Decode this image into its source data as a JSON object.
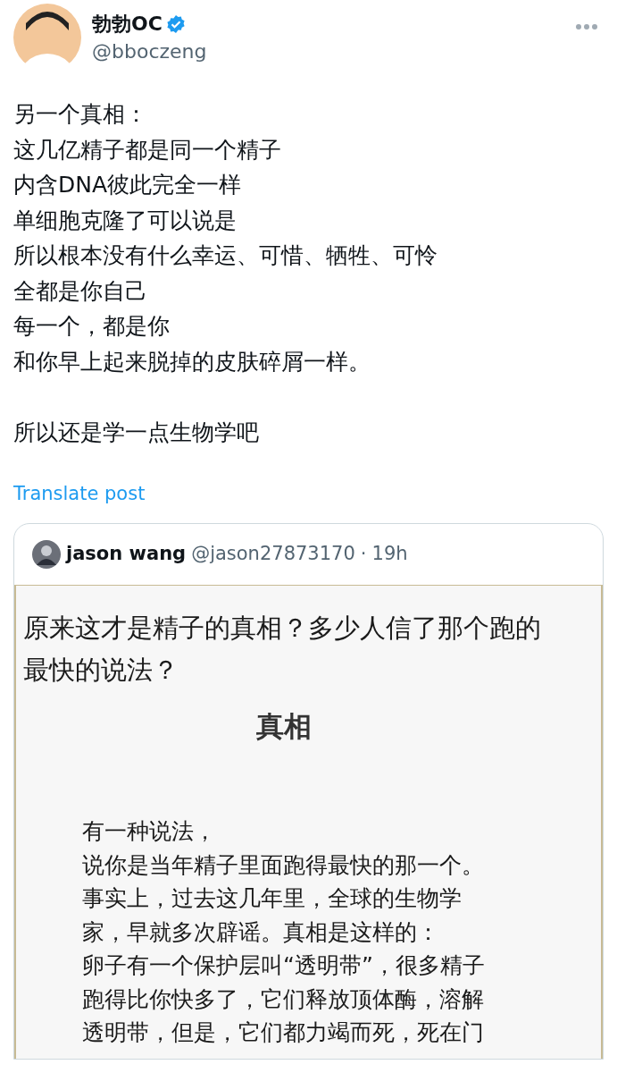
{
  "author": {
    "name": "勃勃OC",
    "verified": true,
    "handle": "@bboczeng"
  },
  "body": [
    [
      "另一个真相：",
      "这几亿精子都是同一个精子",
      "内含DNA彼此完全一样",
      "单细胞克隆了可以说是",
      "所以根本没有什么幸运、可惜、牺牲、可怜",
      "全都是你自己",
      "每一个，都是你",
      "和你早上起来脱掉的皮肤碎屑一样。"
    ],
    [
      "所以还是学一点生物学吧"
    ]
  ],
  "translate_link": "Translate post",
  "quote": {
    "name": "jason wang",
    "handle": "@jason27873170",
    "separator": "·",
    "time": "19h",
    "image": {
      "title_lines": [
        "原来这才是精子的真相？多少人信了那个跑的",
        "最快的说法？"
      ],
      "heading": "真相",
      "paragraph_lines": [
        "有一种说法，",
        "说你是当年精子里面跑得最快的那一个。",
        "事实上，过去这几年里，全球的生物学",
        "家，早就多次辟谣。真相是这样的：",
        "卵子有一个保护层叫“透明带”，很多精子",
        "跑得比你快多了，它们释放顶体酶，溶解",
        "透明带，但是，它们都力竭而死，死在门"
      ]
    }
  }
}
